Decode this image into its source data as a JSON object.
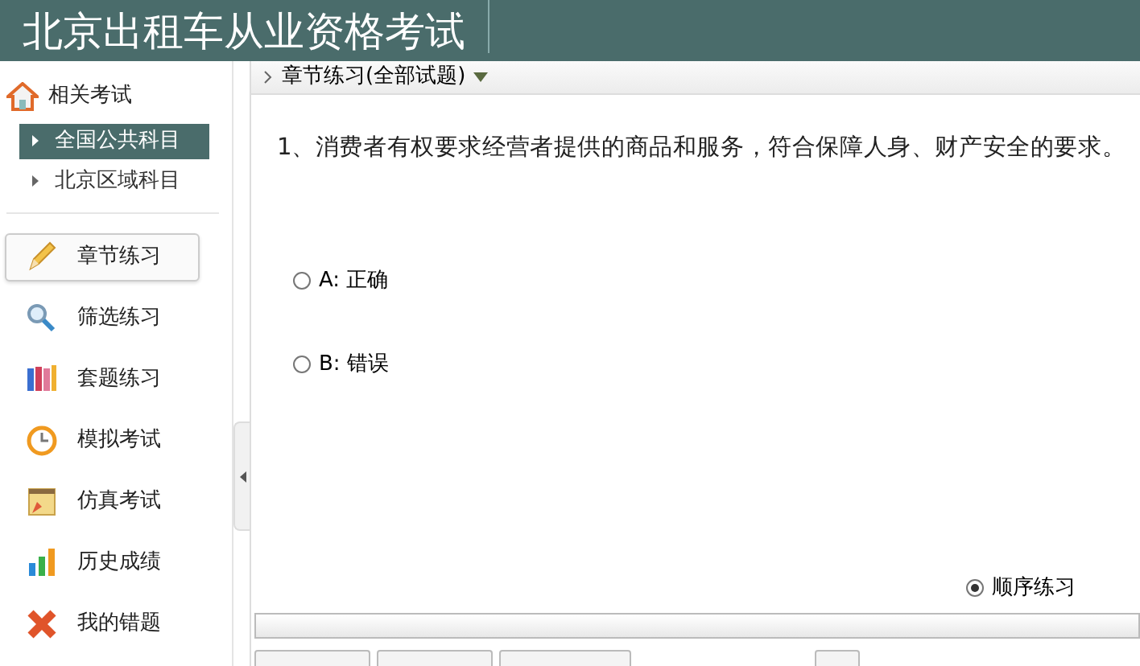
{
  "header": {
    "title": "北京出租车从业资格考试"
  },
  "sidebar": {
    "section_title": "相关考试",
    "subjects": [
      {
        "label": "全国公共科目",
        "selected": true
      },
      {
        "label": "北京区域科目",
        "selected": false
      }
    ],
    "menu": [
      {
        "label": "章节练习",
        "kind": "pencil",
        "selected": true
      },
      {
        "label": "筛选练习",
        "kind": "search",
        "selected": false
      },
      {
        "label": "套题练习",
        "kind": "books",
        "selected": false
      },
      {
        "label": "模拟考试",
        "kind": "clock",
        "selected": false
      },
      {
        "label": "仿真考试",
        "kind": "notepad",
        "selected": false
      },
      {
        "label": "历史成绩",
        "kind": "bars",
        "selected": false
      },
      {
        "label": "我的错题",
        "kind": "cross",
        "selected": false
      }
    ]
  },
  "breadcrumb": {
    "label": "章节练习(全部试题)"
  },
  "question": {
    "text": "1、消费者有权要求经营者提供的商品和服务，符合保障人身、财产安全的要求。",
    "options": [
      {
        "label": "A: 正确",
        "selected": false
      },
      {
        "label": "B: 错误",
        "selected": false
      }
    ]
  },
  "mode": {
    "label": "顺序练习",
    "selected": true
  }
}
